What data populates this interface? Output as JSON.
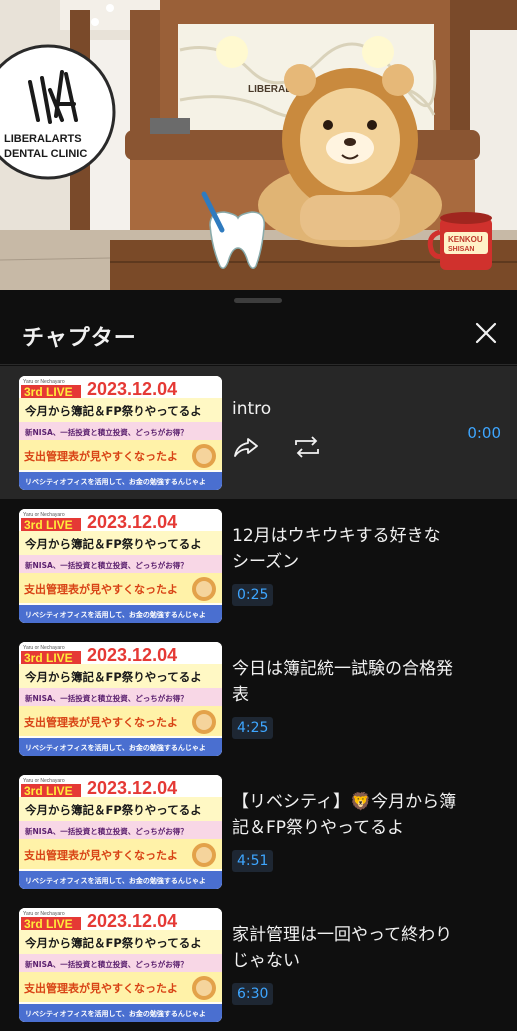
{
  "video": {
    "clinic_logo_line1": "LIBERALARTS",
    "clinic_logo_line2": "DENTAL CLINIC",
    "wall_sign": "LIBERAL",
    "mug_text1": "KENKOU",
    "mug_text2": "SHISAN"
  },
  "sheet": {
    "title": "チャプター"
  },
  "thumbnail": {
    "small_label": "Yaru or Nechayaro",
    "badge": "3rd LIVE",
    "date": "2023.12.04",
    "line1": "今月から簿記＆FP祭りやってるよ",
    "line2": "新NISA、一括投資と積立投資、どっちがお得？",
    "line3": "支出管理表が見やすくなったよ",
    "line4": "リベシティオフィスを活用して、お金の勉強するんじゃよ"
  },
  "chapters": [
    {
      "title": "intro",
      "time": "0:00",
      "active": true
    },
    {
      "title": "12月はウキウキする好きなシーズン",
      "time": "0:25",
      "active": false
    },
    {
      "title": "今日は簿記統一試験の合格発表",
      "time": "4:25",
      "active": false
    },
    {
      "title": "【リベシティ】🦁今月から簿記＆FP祭りやってるよ",
      "time": "4:51",
      "active": false
    },
    {
      "title": "家計管理は一回やって終わりじゃない",
      "time": "6:30",
      "active": false
    }
  ],
  "colors": {
    "accent_blue": "#3ea6ff",
    "sheet_bg": "#0f0f0f",
    "active_row_bg": "#272727",
    "thumb_red": "#e53935",
    "thumb_yellow": "#fff176"
  },
  "icons": [
    "close-icon",
    "share-icon",
    "loop-icon"
  ]
}
